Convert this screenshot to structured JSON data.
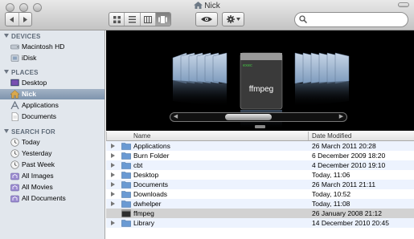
{
  "window": {
    "title": "Nick"
  },
  "sidebar": {
    "sections": [
      {
        "header": "DEVICES",
        "items": [
          {
            "label": "Macintosh HD",
            "icon": "hard-drive-icon"
          },
          {
            "label": "iDisk",
            "icon": "idisk-icon"
          }
        ]
      },
      {
        "header": "PLACES",
        "items": [
          {
            "label": "Desktop",
            "icon": "desktop-icon"
          },
          {
            "label": "Nick",
            "icon": "home-icon",
            "selected": true
          },
          {
            "label": "Applications",
            "icon": "applications-icon"
          },
          {
            "label": "Documents",
            "icon": "documents-icon"
          }
        ]
      },
      {
        "header": "SEARCH FOR",
        "items": [
          {
            "label": "Today",
            "icon": "clock-icon"
          },
          {
            "label": "Yesterday",
            "icon": "clock-icon"
          },
          {
            "label": "Past Week",
            "icon": "clock-icon"
          },
          {
            "label": "All Images",
            "icon": "smart-folder-icon"
          },
          {
            "label": "All Movies",
            "icon": "smart-folder-icon"
          },
          {
            "label": "All Documents",
            "icon": "smart-folder-icon"
          }
        ]
      }
    ]
  },
  "coverflow": {
    "selected_label": "ffmpeg",
    "selected_icon": "unix-executable-icon"
  },
  "list": {
    "headers": {
      "name": "Name",
      "date_modified": "Date Modified"
    },
    "rows": [
      {
        "name": "Applications",
        "date": "26 March 2011 20:28",
        "kind": "folder"
      },
      {
        "name": "Burn Folder",
        "date": "6 December 2009 18:20",
        "kind": "folder"
      },
      {
        "name": "cbt",
        "date": "4 December 2010 19:10",
        "kind": "folder"
      },
      {
        "name": "Desktop",
        "date": "Today, 11:06",
        "kind": "folder"
      },
      {
        "name": "Documents",
        "date": "26 March 2011 21:11",
        "kind": "folder"
      },
      {
        "name": "Downloads",
        "date": "Today, 10:52",
        "kind": "folder"
      },
      {
        "name": "dwhelper",
        "date": "Today, 11:08",
        "kind": "folder"
      },
      {
        "name": "ffmpeg",
        "date": "26 January 2008 21:12",
        "kind": "executable",
        "selected": true
      },
      {
        "name": "Library",
        "date": "14 December 2010 20:45",
        "kind": "folder"
      }
    ]
  },
  "colors": {
    "accent": "#7e94ad",
    "folder": "#6a9ad3",
    "list_alt": "#edf3fe",
    "selection": "#d2d2d2"
  }
}
